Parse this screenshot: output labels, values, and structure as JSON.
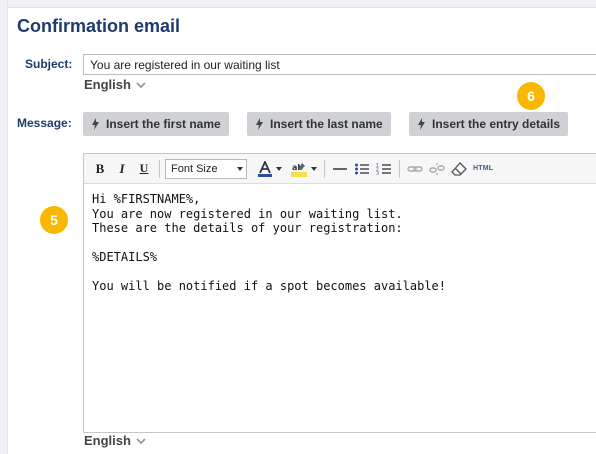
{
  "section": {
    "title": "Confirmation email"
  },
  "subject": {
    "label": "Subject:",
    "value": "You are registered in our waiting list"
  },
  "message": {
    "label": "Message:",
    "insert_buttons": [
      "Insert the first name",
      "Insert the last name",
      "Insert the entry details"
    ]
  },
  "language": {
    "subject_lang": "English",
    "message_lang": "English"
  },
  "badges": {
    "editor_badge": "5",
    "buttons_badge": "6"
  },
  "toolbar": {
    "bold": "B",
    "italic": "I",
    "underline": "U",
    "font_size": "Font Size",
    "html_label": "HTML"
  },
  "editor_body": {
    "lines": [
      "Hi %FIRSTNAME%,",
      "You are now registered in our waiting list.",
      "These are the details of your registration:",
      "",
      "%DETAILS%",
      "",
      "You will be notified if a spot becomes available!"
    ]
  },
  "colors": {
    "heading": "#1f3a6d",
    "badge": "#f9b800",
    "button_bg": "#d0d1d4"
  }
}
